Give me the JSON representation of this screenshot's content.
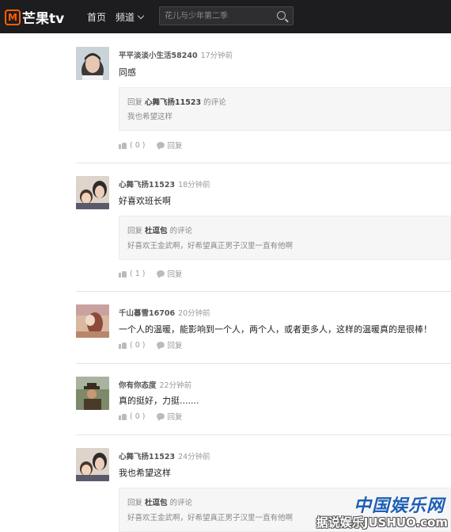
{
  "header": {
    "logo_mark": "M",
    "logo_text": "芒果tv",
    "nav": [
      {
        "label": "首页"
      },
      {
        "label": "频道"
      }
    ],
    "search_placeholder": "花儿与少年第二季",
    "colors": {
      "bar": "#1d1d1f",
      "brand": "#ff5f00"
    }
  },
  "comments": [
    {
      "user": "平平淡淡小生活58240",
      "time": "17分钟前",
      "text": "同感",
      "reply": {
        "prefix": "回复",
        "target": "心舞飞扬11523",
        "suffix": "的评论",
        "body": "我也希望这样"
      },
      "likes": "( 0 )",
      "reply_label": "回复"
    },
    {
      "user": "心舞飞扬11523",
      "time": "18分钟前",
      "text": "好喜欢班长啊",
      "reply": {
        "prefix": "回复",
        "target": "杜逗包",
        "suffix": "的评论",
        "body": "好喜欢王金武啊，好希望真正男子汉里一直有他啊"
      },
      "likes": "( 1 )",
      "reply_label": "回复"
    },
    {
      "user": "千山暮雪16706",
      "time": "20分钟前",
      "text": "一个人的温暖，能影响到一个人，两个人，或者更多人，这样的温暖真的是很棒！",
      "likes": "( 0 )",
      "reply_label": "回复"
    },
    {
      "user": "你有你态度",
      "time": "22分钟前",
      "text": "真的挺好，力挺.......",
      "likes": "( 0 )",
      "reply_label": "回复"
    },
    {
      "user": "心舞飞扬11523",
      "time": "24分钟前",
      "text": "我也希望这样",
      "reply": {
        "prefix": "回复",
        "target": "杜逗包",
        "suffix": "的评论",
        "body": "好喜欢王金武啊，好希望真正男子汉里一直有他啊"
      }
    }
  ],
  "watermark": {
    "brand": "中国娱乐网",
    "sub": "据说娱乐JUSHUO.com"
  }
}
